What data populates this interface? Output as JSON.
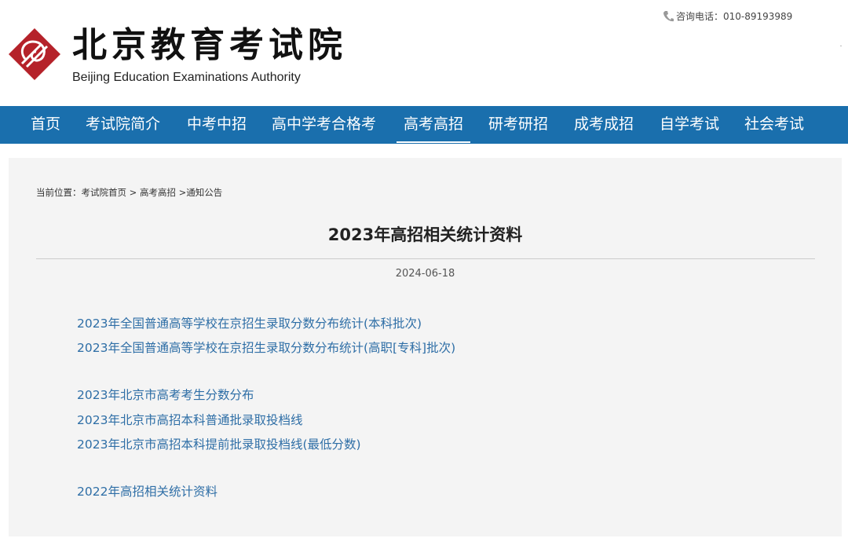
{
  "header": {
    "brand_cn": "北京教育考试院",
    "brand_en": "Beijing Education Examinations Authority",
    "phone": "咨询电话：010-89193989"
  },
  "nav": {
    "items": [
      {
        "label": "首页"
      },
      {
        "label": "考试院简介"
      },
      {
        "label": "中考中招"
      },
      {
        "label": "高中学考合格考"
      },
      {
        "label": "高考高招"
      },
      {
        "label": "研考研招"
      },
      {
        "label": "成考成招"
      },
      {
        "label": "自学考试"
      },
      {
        "label": "社会考试"
      }
    ],
    "active": "高考高招"
  },
  "breadcrumb": "当前位置：考试院首页 > 高考高招 >通知公告",
  "article": {
    "title": "2023年高招相关统计资料",
    "date": "2024-06-18",
    "links": [
      "2023年全国普通高等学校在京招生录取分数分布统计(本科批次)",
      "2023年全国普通高等学校在京招生录取分数分布统计(高职[专科]批次)",
      "2023年北京市高考考生分数分布",
      "2023年北京市高招本科普通批录取投档线",
      "2023年北京市高招本科提前批录取投档线(最低分数)",
      "2022年高招相关统计资料"
    ]
  },
  "colors": {
    "nav_bg": "#1a6fad",
    "logo_red": "#b5222a",
    "link": "#2e6ea6",
    "content_bg": "#f4f4f4"
  },
  "icons": {
    "logo": "bjeea-logo-icon",
    "phone": "phone-icon"
  }
}
